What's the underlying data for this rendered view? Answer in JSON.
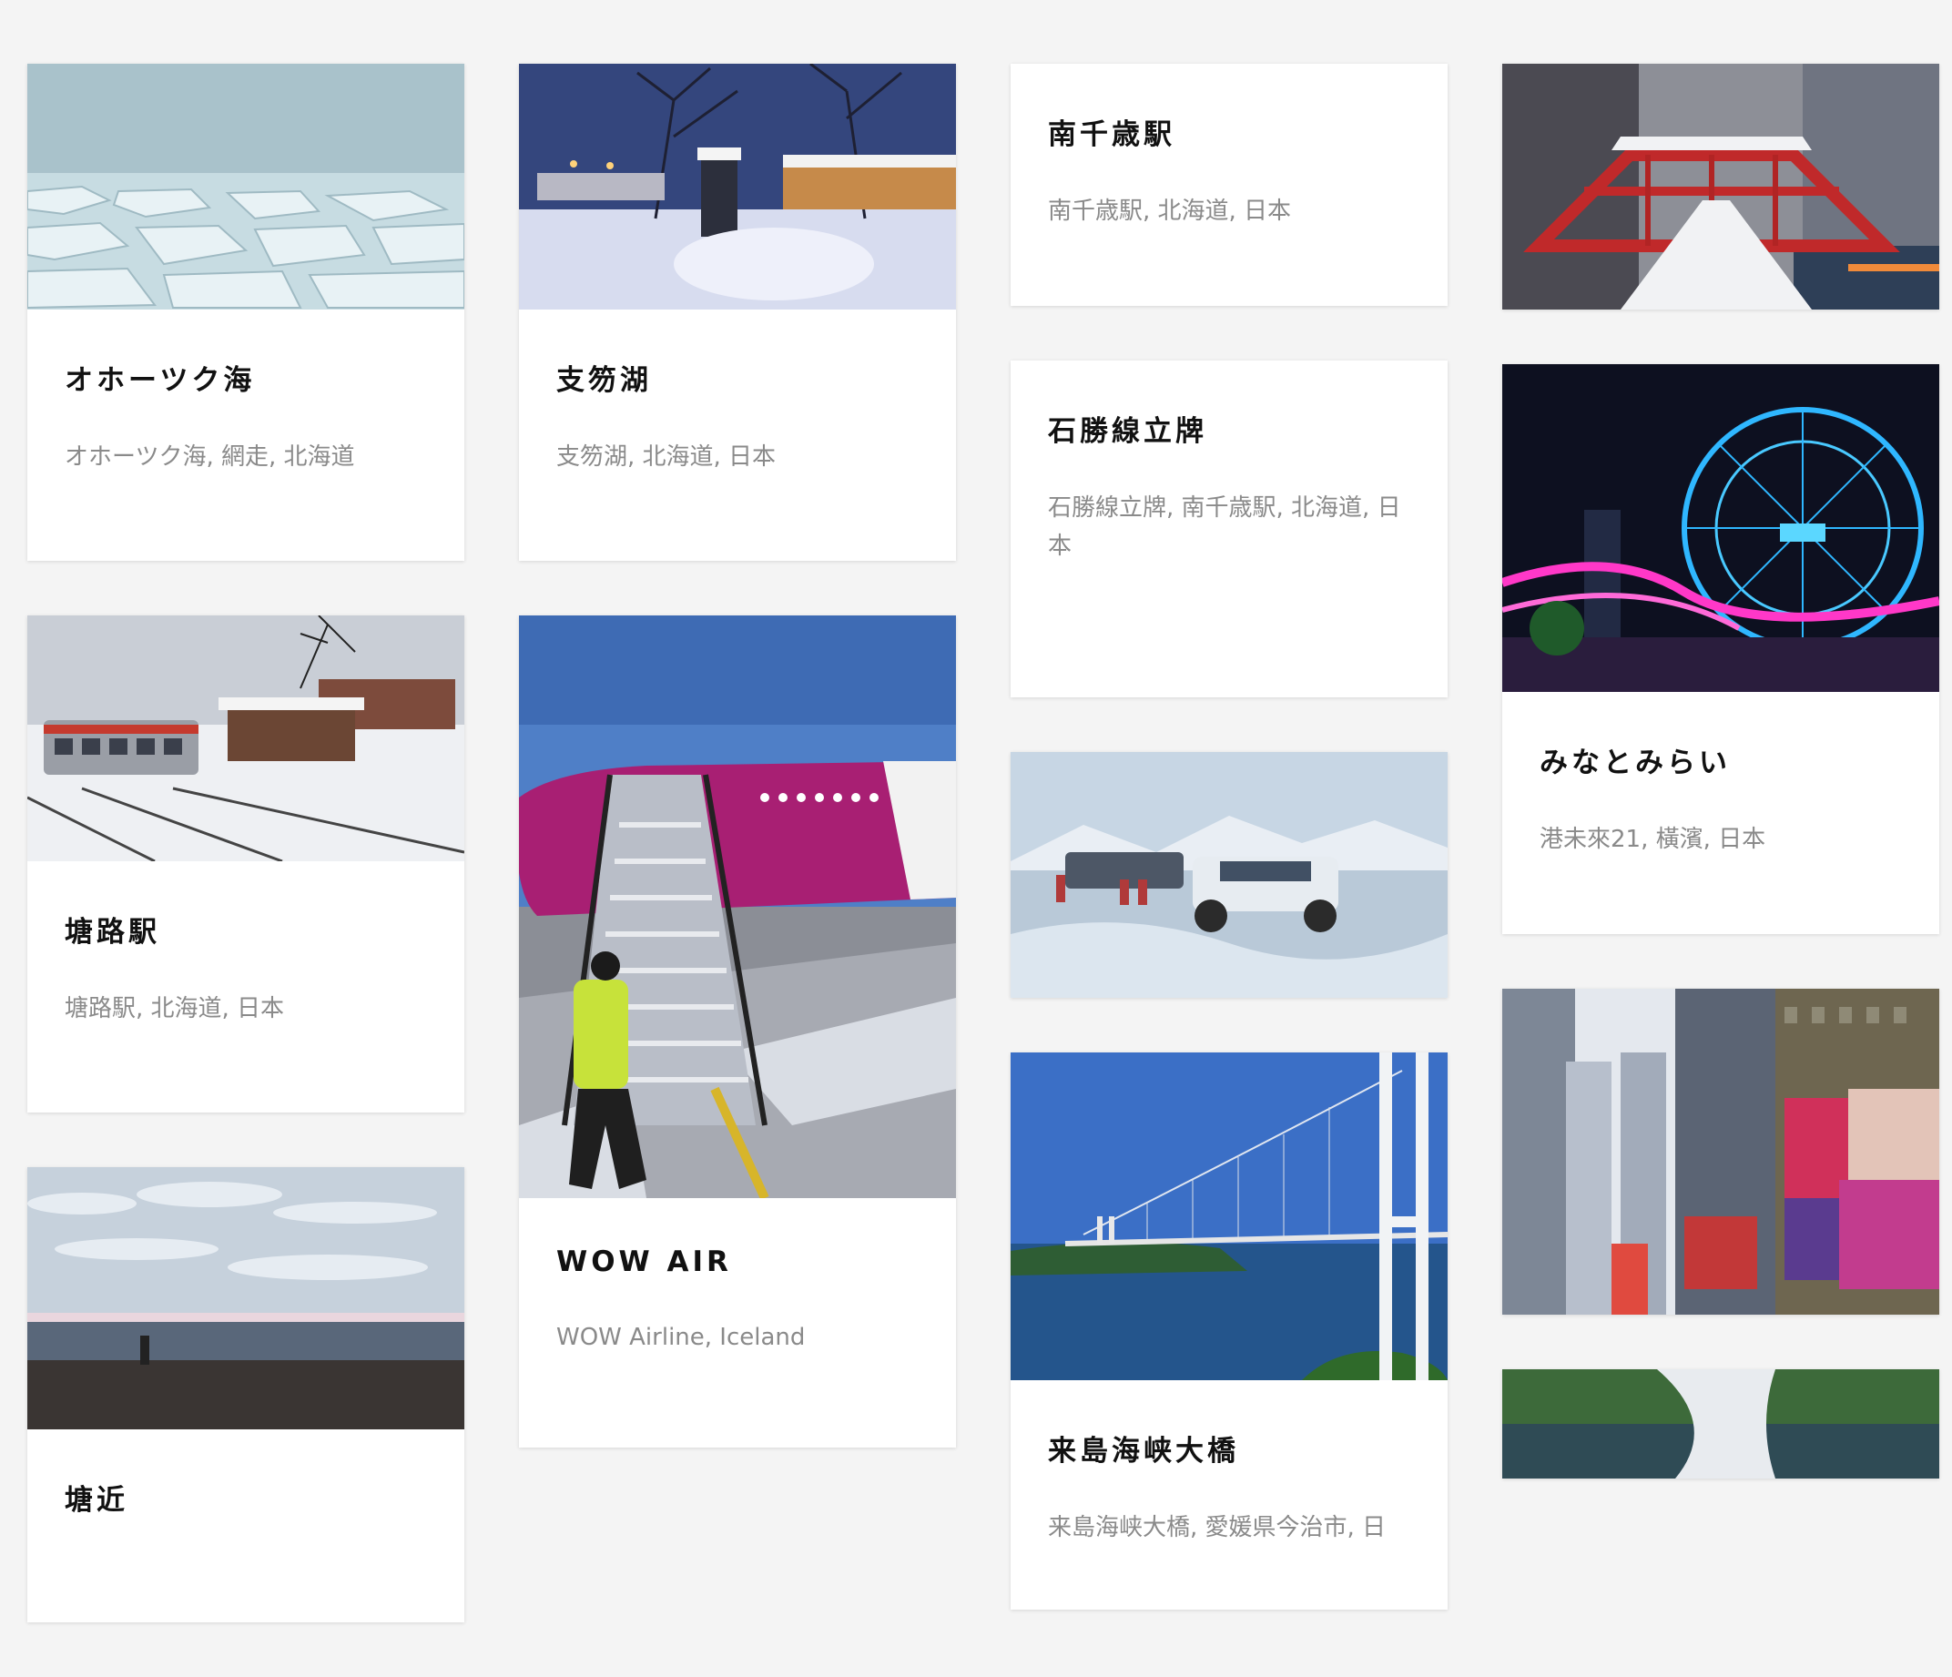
{
  "cards": [
    {
      "title": "オホーツク海",
      "location": "オホーツク海, 網走, 北海道"
    },
    {
      "title": "支笏湖",
      "location": "支笏湖, 北海道, 日本"
    },
    {
      "title": "南千歳駅",
      "location": "南千歳駅, 北海道, 日本"
    },
    {
      "title": "",
      "location": ""
    },
    {
      "title": "石勝線立牌",
      "location": "石勝線立牌, 南千歳駅, 北海道, 日本"
    },
    {
      "title": "みなとみらい",
      "location": "港未來21, 橫濱, 日本"
    },
    {
      "title": "塘路駅",
      "location": "塘路駅, 北海道, 日本"
    },
    {
      "title": "WOW AIR",
      "location": "WOW Airline, Iceland"
    },
    {
      "title": "",
      "location": ""
    },
    {
      "title": "来島海峡大橋",
      "location": "来島海峡大橋, 愛媛県今治市, 日"
    },
    {
      "title": "",
      "location": ""
    },
    {
      "title": "",
      "location": ""
    },
    {
      "title": "塘近",
      "location": ""
    },
    {
      "title": "",
      "location": ""
    }
  ]
}
